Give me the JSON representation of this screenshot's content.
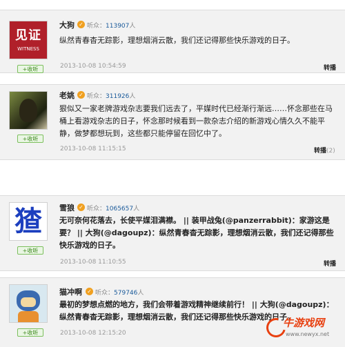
{
  "posts": [
    {
      "name": "大狗",
      "fans_label": "听众：",
      "fans_count": "113907",
      "fans_unit": "人",
      "text": "纵然青春杳无踪影，理想烟消云散，我们还记得那些快乐游戏的日子。",
      "time": "2013-10-08 10:54:59",
      "repost_label": "转播",
      "repost_count": "",
      "follow_label": "+收听",
      "avatar_text_top": "见证",
      "avatar_text_bottom": "WITNESS"
    },
    {
      "name": "老姚",
      "fans_label": "听众：",
      "fans_count": "311926",
      "fans_unit": "人",
      "text": "狠似又一家老牌游戏杂志要我们远去了，平媒时代已经渐行渐远……怀念那些在马桶上看游戏杂志的日子，怀念那时候看到一款杂志介绍的新游戏心情久久不能平静，做梦都想玩到，这些都只能停留在回忆中了。",
      "time": "2013-10-08 11:15:15",
      "repost_label": "转播",
      "repost_count": "(2)",
      "follow_label": "+收听"
    },
    {
      "name": "雪狼",
      "fans_label": "听众：",
      "fans_count": "1065657",
      "fans_unit": "人",
      "text": "无可奈何花落去，长使平媒泪满襟。 || 装甲战兔(@panzerrabbit)：家游这是要？ || 大狗(@dagoupz)：纵然青春杳无踪影，理想烟消云散，我们还记得那些快乐游戏的日子。",
      "time": "2013-10-08 11:10:55",
      "repost_label": "转播",
      "repost_count": "",
      "follow_label": "+收听",
      "avatar_glyph": "猹"
    },
    {
      "name": "猫冲啊",
      "fans_label": "听众：",
      "fans_count": "579746",
      "fans_unit": "人",
      "text": "最初的梦想点燃的地方，我们会带着游戏精神继续前行！ || 大狗(@dagoupz)：纵然青春杳无踪影，理想烟消云散，我们还记得那些快乐游戏的日子。",
      "time": "2013-10-08 12:15:20",
      "follow_label": "+收听"
    }
  ],
  "watermark": {
    "brand": "牛游戏网",
    "url": "www.newyx.net"
  },
  "colors": {
    "card_bg": "#f2f2f2",
    "badge": "#f0a020",
    "fans_num": "#1a5a9a",
    "follow_green": "#3e8a1e",
    "avatar_red": "#b0202a",
    "avatar_blue": "#1c3fbf"
  }
}
